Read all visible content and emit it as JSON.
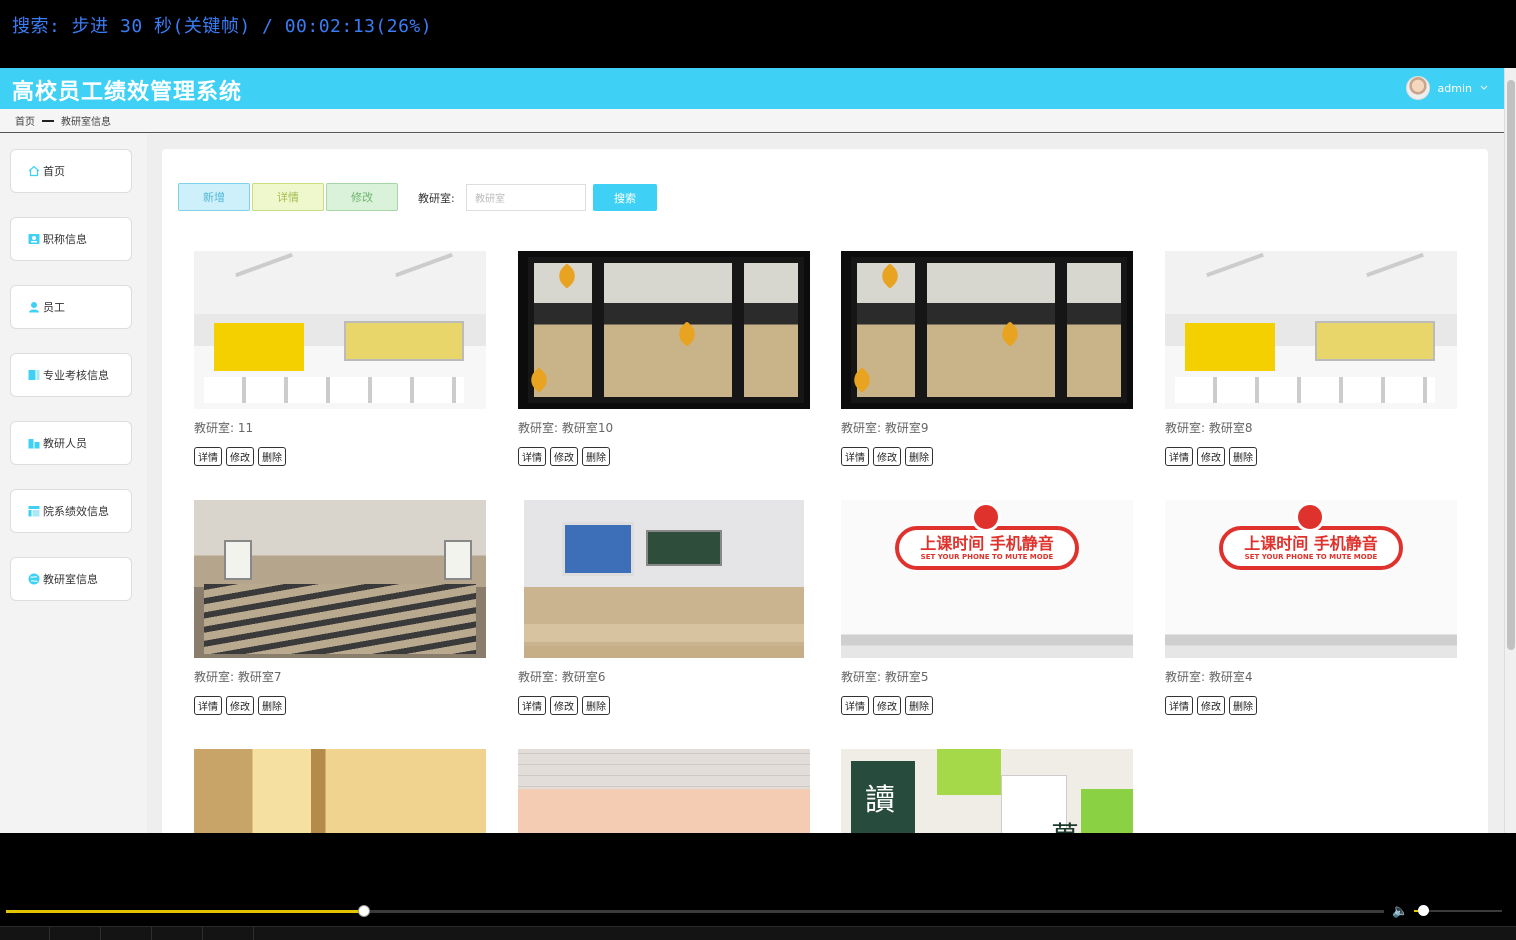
{
  "osd": "搜索: 步进 30 秒(关键帧) / 00:02:13(26%)",
  "app": {
    "title": "高校员工绩效管理系统",
    "user": "admin"
  },
  "breadcrumb": {
    "home": "首页",
    "current": "教研室信息"
  },
  "sidebar": {
    "items": [
      {
        "label": "首页",
        "icon": "home-icon"
      },
      {
        "label": "职称信息",
        "icon": "id-card-icon"
      },
      {
        "label": "员工",
        "icon": "user-icon"
      },
      {
        "label": "专业考核信息",
        "icon": "book-icon"
      },
      {
        "label": "教研人员",
        "icon": "building-icon"
      },
      {
        "label": "院系绩效信息",
        "icon": "chart-icon"
      },
      {
        "label": "教研室信息",
        "icon": "globe-icon"
      }
    ]
  },
  "toolbar": {
    "add_label": "新增",
    "detail_label": "详情",
    "edit_label": "修改",
    "search_label": "教研室:",
    "search_placeholder": "教研室",
    "search_button": "搜索"
  },
  "card_actions": {
    "detail": "详情",
    "edit": "修改",
    "delete": "删除"
  },
  "cards": [
    {
      "label": "教研室: 11",
      "scene": "bright-classroom"
    },
    {
      "label": "教研室: 教研室10",
      "scene": "window-classroom"
    },
    {
      "label": "教研室: 教研室9",
      "scene": "window-classroom"
    },
    {
      "label": "教研室: 教研室8",
      "scene": "bright-classroom"
    },
    {
      "label": "教研室: 教研室7",
      "scene": "lecture-hall"
    },
    {
      "label": "教研室: 教研室6",
      "scene": "projector-classroom"
    },
    {
      "label": "教研室: 教研室5",
      "scene": "mute-sign"
    },
    {
      "label": "教研室: 教研室4",
      "scene": "mute-sign"
    },
    {
      "label": "",
      "scene": "sunlit-room"
    },
    {
      "label": "",
      "scene": "ceiling-classroom"
    },
    {
      "label": "",
      "scene": "poster-wall"
    }
  ],
  "sign": {
    "main": "上课时间 手机静音",
    "sub": "SET YOUR PHONE TO MUTE MODE"
  },
  "poster": {
    "char1": "讀",
    "char2": "萬"
  },
  "player": {
    "progress": 0.26,
    "volume": 0.1
  },
  "colors": {
    "accent": "#3fd1f5",
    "osd": "#3b7cf5",
    "seek": "#e4c300"
  }
}
